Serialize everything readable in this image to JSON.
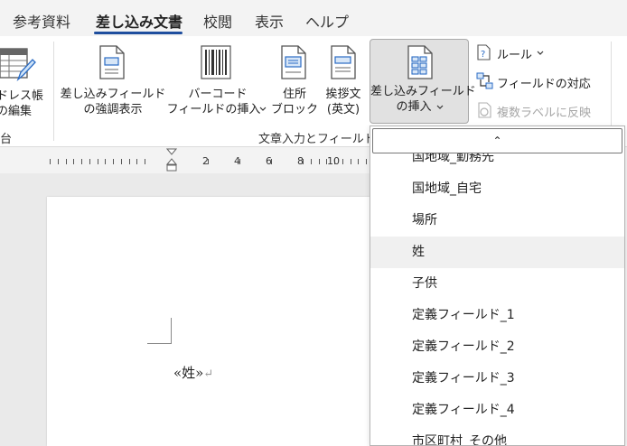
{
  "tabs": [
    {
      "label": "参考資料",
      "active": false
    },
    {
      "label": "差し込み文書",
      "active": true
    },
    {
      "label": "校閲",
      "active": false
    },
    {
      "label": "表示",
      "active": false
    },
    {
      "label": "ヘルプ",
      "active": false
    }
  ],
  "ribbon": {
    "address_book": {
      "line1": "ドレス帳",
      "line2": "の編集"
    },
    "group_left_label": "台",
    "highlight_fields": {
      "line1": "差し込みフィールド",
      "line2": "の強調表示"
    },
    "barcode": {
      "line1": "バーコード",
      "line2": "フィールドの挿入"
    },
    "address_block": {
      "line1": "住所",
      "line2": "ブロック"
    },
    "greeting": {
      "line1": "挨拶文",
      "line2": "(英文)"
    },
    "insert_merge_field": {
      "line1": "差し込みフィールド",
      "line2": "の挿入"
    },
    "rules_label": "ルール",
    "match_fields_label": "フィールドの対応",
    "update_labels_label": "複数ラベルに反映",
    "group_label": "文章入力とフィールド",
    "accent_color": "#1f4e9e"
  },
  "ruler": {
    "numbers": [
      "2",
      "4",
      "6",
      "8",
      "10"
    ]
  },
  "document": {
    "field_text": "«姓»",
    "paragraph_mark": "↵"
  },
  "dropdown": {
    "scroll_up_glyph": "⌃",
    "items": [
      "国地域_勤務先",
      "国地域_自宅",
      "場所",
      "姓",
      "子供",
      "定義フィールド_1",
      "定義フィールド_2",
      "定義フィールド_3",
      "定義フィールド_4",
      "市区町村_その他"
    ],
    "hover_index": 3
  }
}
